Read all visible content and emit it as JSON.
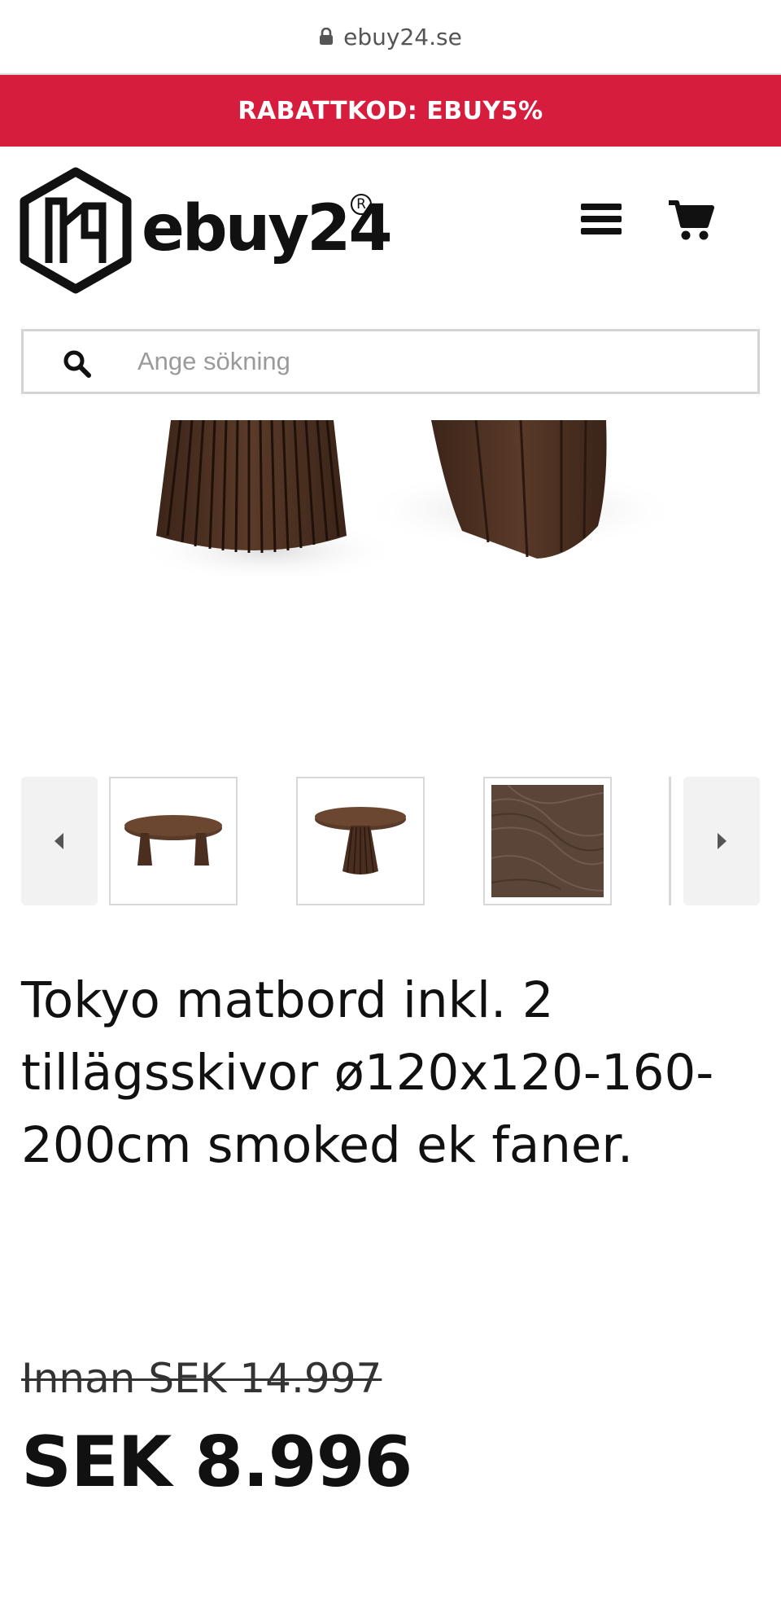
{
  "browser": {
    "url": "ebuy24.se"
  },
  "promo": {
    "text": "RABATTKOD: EBUY5%",
    "color": "#d71d3d"
  },
  "header": {
    "logo_text": "ebuy24",
    "logo_reg": "R",
    "menu_icon": "hamburger-icon",
    "cart_icon": "cart-icon"
  },
  "search": {
    "placeholder": "Ange sökning",
    "value": "",
    "icon": "search-icon"
  },
  "gallery": {
    "prev_icon": "caret-left-icon",
    "next_icon": "caret-right-icon",
    "thumbnails": [
      {
        "alt": "oval-table"
      },
      {
        "alt": "round-table"
      },
      {
        "alt": "wood-veneer"
      }
    ]
  },
  "product": {
    "title": "Tokyo matbord inkl. 2 tillägsskivor ø120x120-160-200cm smoked ek faner.",
    "old_price": "Innan SEK 14.997",
    "price": "SEK 8.996"
  }
}
